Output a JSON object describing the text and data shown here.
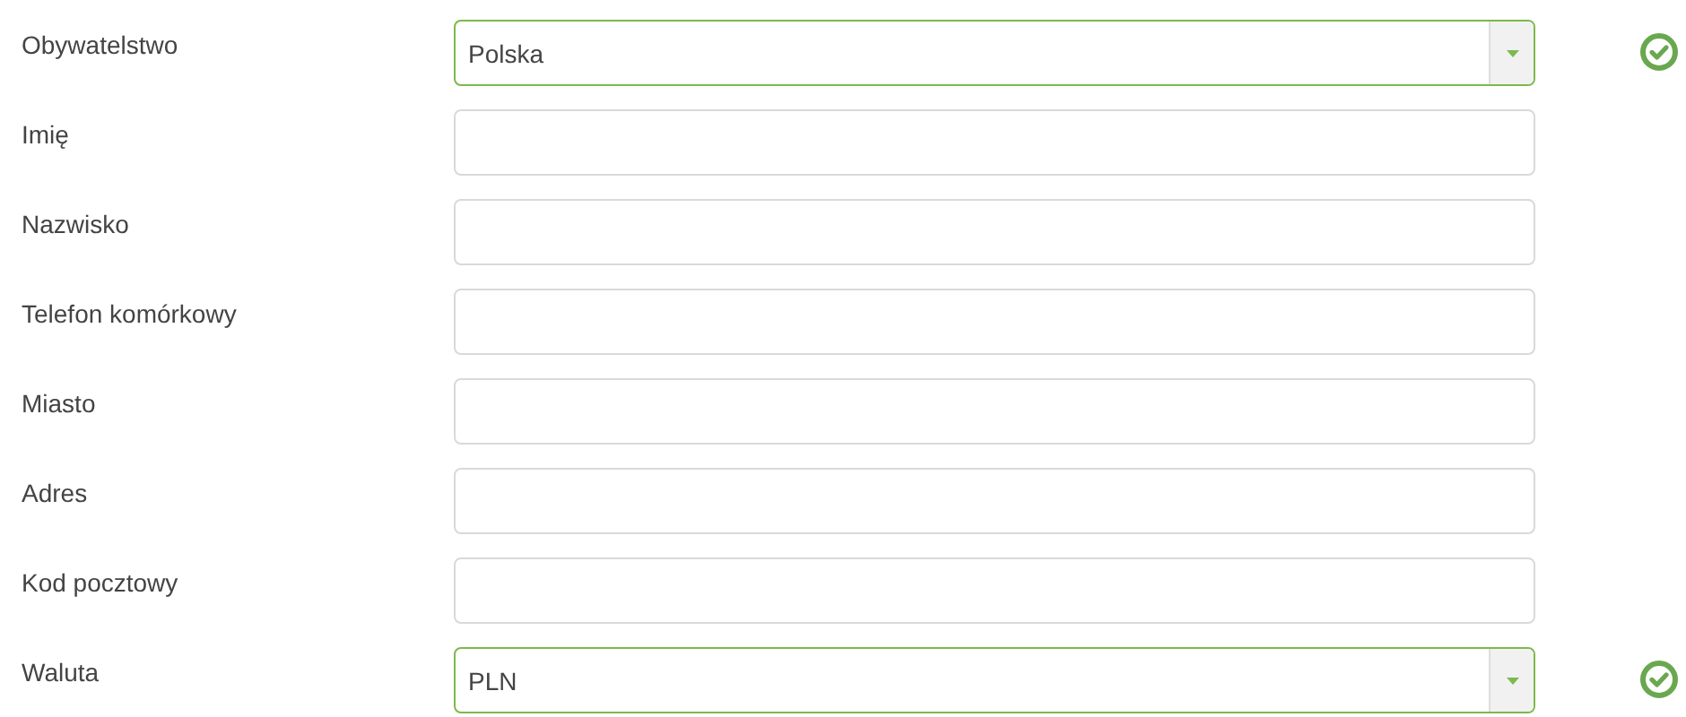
{
  "fields": [
    {
      "label": "Obywatelstwo",
      "kind": "select",
      "value": "Polska",
      "valid": true
    },
    {
      "label": "Imię",
      "kind": "text",
      "valid": false
    },
    {
      "label": "Nazwisko",
      "kind": "text",
      "valid": false
    },
    {
      "label": "Telefon komórkowy",
      "kind": "text",
      "valid": false
    },
    {
      "label": "Miasto",
      "kind": "text",
      "valid": false
    },
    {
      "label": "Adres",
      "kind": "text",
      "valid": false
    },
    {
      "label": "Kod pocztowy",
      "kind": "text",
      "valid": false
    },
    {
      "label": "Waluta",
      "kind": "select",
      "value": "PLN",
      "valid": true
    }
  ]
}
